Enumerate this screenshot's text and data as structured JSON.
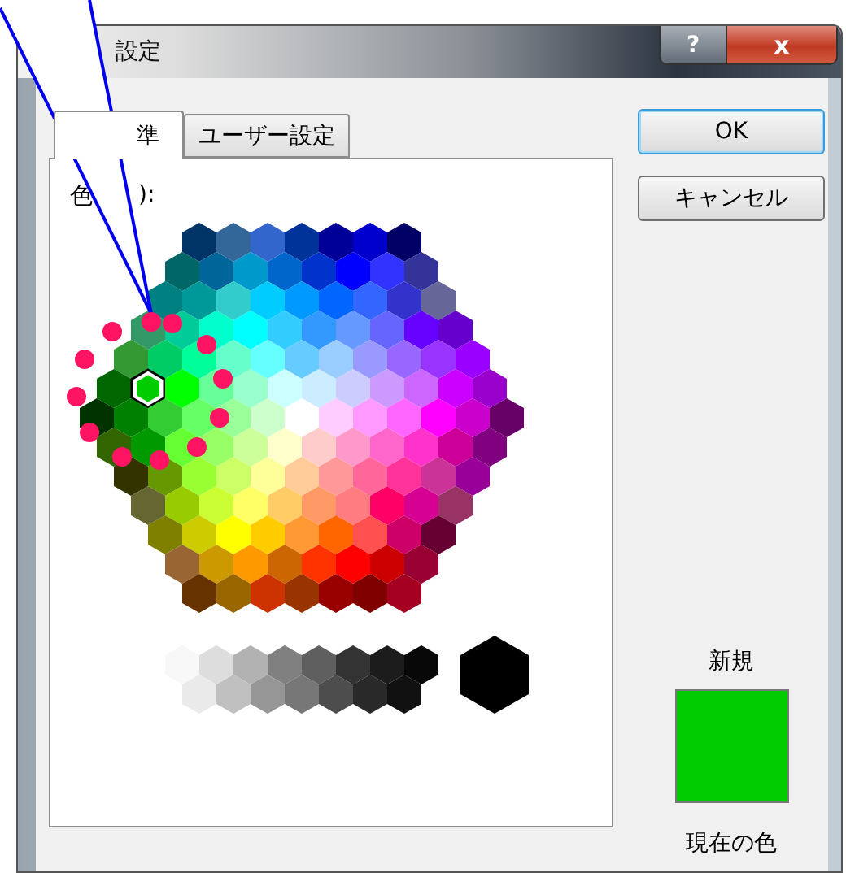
{
  "window": {
    "title": "設定",
    "help_button": "?",
    "close_button": "x"
  },
  "tabs": [
    {
      "label": "準",
      "selected": true
    },
    {
      "label": "ユーザー設定",
      "selected": false
    }
  ],
  "colors_label": {
    "start": "色",
    "end": "):"
  },
  "palette": {
    "rows": [
      [
        {
          "color": "#003366",
          "selected": false
        },
        {
          "color": "#336699",
          "selected": false
        },
        {
          "color": "#3366cc",
          "selected": false
        },
        {
          "color": "#003399",
          "selected": false
        },
        {
          "color": "#000099",
          "selected": false
        },
        {
          "color": "#0000cc",
          "selected": false
        },
        {
          "color": "#000066",
          "selected": false
        }
      ],
      [
        {
          "color": "#006666",
          "selected": false
        },
        {
          "color": "#006699",
          "selected": false
        },
        {
          "color": "#0099cc",
          "selected": false
        },
        {
          "color": "#0066cc",
          "selected": false
        },
        {
          "color": "#0033cc",
          "selected": false
        },
        {
          "color": "#0000ff",
          "selected": false
        },
        {
          "color": "#3333ff",
          "selected": false
        },
        {
          "color": "#333399",
          "selected": false
        }
      ],
      [
        {
          "color": "#008080",
          "selected": false
        },
        {
          "color": "#009999",
          "selected": false
        },
        {
          "color": "#33cccc",
          "selected": false
        },
        {
          "color": "#00ccff",
          "selected": false
        },
        {
          "color": "#0099ff",
          "selected": false
        },
        {
          "color": "#0066ff",
          "selected": false
        },
        {
          "color": "#3366ff",
          "selected": false
        },
        {
          "color": "#3333cc",
          "selected": false
        },
        {
          "color": "#666699",
          "selected": false
        }
      ],
      [
        {
          "color": "#339966",
          "selected": false
        },
        {
          "color": "#00cc99",
          "selected": false
        },
        {
          "color": "#00ffcc",
          "selected": false
        },
        {
          "color": "#00ffff",
          "selected": false
        },
        {
          "color": "#33ccff",
          "selected": false
        },
        {
          "color": "#3399ff",
          "selected": false
        },
        {
          "color": "#6699ff",
          "selected": false
        },
        {
          "color": "#6666ff",
          "selected": false
        },
        {
          "color": "#6600ff",
          "selected": false
        },
        {
          "color": "#6600cc",
          "selected": false
        }
      ],
      [
        {
          "color": "#339933",
          "selected": false
        },
        {
          "color": "#00cc66",
          "selected": false
        },
        {
          "color": "#00ff99",
          "selected": false
        },
        {
          "color": "#66ffcc",
          "selected": false
        },
        {
          "color": "#66ffff",
          "selected": false
        },
        {
          "color": "#66ccff",
          "selected": false
        },
        {
          "color": "#99ccff",
          "selected": false
        },
        {
          "color": "#9999ff",
          "selected": false
        },
        {
          "color": "#9966ff",
          "selected": false
        },
        {
          "color": "#9933ff",
          "selected": false
        },
        {
          "color": "#9900ff",
          "selected": false
        }
      ],
      [
        {
          "color": "#006600",
          "selected": false
        },
        {
          "color": "#00cc00",
          "selected": true
        },
        {
          "color": "#00ff00",
          "selected": false
        },
        {
          "color": "#66ff99",
          "selected": false
        },
        {
          "color": "#99ffcc",
          "selected": false
        },
        {
          "color": "#ccffff",
          "selected": false
        },
        {
          "color": "#ccecff",
          "selected": false
        },
        {
          "color": "#ccccff",
          "selected": false
        },
        {
          "color": "#cc99ff",
          "selected": false
        },
        {
          "color": "#cc66ff",
          "selected": false
        },
        {
          "color": "#cc00ff",
          "selected": false
        },
        {
          "color": "#9900cc",
          "selected": false
        }
      ],
      [
        {
          "color": "#003300",
          "selected": false
        },
        {
          "color": "#008000",
          "selected": false
        },
        {
          "color": "#33cc33",
          "selected": false
        },
        {
          "color": "#66ff66",
          "selected": false
        },
        {
          "color": "#99ff99",
          "selected": false
        },
        {
          "color": "#ccffcc",
          "selected": false
        },
        {
          "color": "#ffffff",
          "selected": false
        },
        {
          "color": "#ffccff",
          "selected": false
        },
        {
          "color": "#ff99ff",
          "selected": false
        },
        {
          "color": "#ff66ff",
          "selected": false
        },
        {
          "color": "#ff00ff",
          "selected": false
        },
        {
          "color": "#cc00cc",
          "selected": false
        },
        {
          "color": "#660066",
          "selected": false
        }
      ],
      [
        {
          "color": "#336600",
          "selected": false
        },
        {
          "color": "#009900",
          "selected": false
        },
        {
          "color": "#66ff33",
          "selected": false
        },
        {
          "color": "#99ff66",
          "selected": false
        },
        {
          "color": "#ccff99",
          "selected": false
        },
        {
          "color": "#ffffcc",
          "selected": false
        },
        {
          "color": "#ffcccc",
          "selected": false
        },
        {
          "color": "#ff99cc",
          "selected": false
        },
        {
          "color": "#ff66cc",
          "selected": false
        },
        {
          "color": "#ff33cc",
          "selected": false
        },
        {
          "color": "#cc0099",
          "selected": false
        },
        {
          "color": "#800080",
          "selected": false
        }
      ],
      [
        {
          "color": "#333300",
          "selected": false
        },
        {
          "color": "#669900",
          "selected": false
        },
        {
          "color": "#99ff33",
          "selected": false
        },
        {
          "color": "#ccff66",
          "selected": false
        },
        {
          "color": "#ffff99",
          "selected": false
        },
        {
          "color": "#ffcc99",
          "selected": false
        },
        {
          "color": "#ff9999",
          "selected": false
        },
        {
          "color": "#ff6699",
          "selected": false
        },
        {
          "color": "#ff3399",
          "selected": false
        },
        {
          "color": "#cc3399",
          "selected": false
        },
        {
          "color": "#990099",
          "selected": false
        }
      ],
      [
        {
          "color": "#666633",
          "selected": false
        },
        {
          "color": "#99cc00",
          "selected": false
        },
        {
          "color": "#ccff33",
          "selected": false
        },
        {
          "color": "#ffff66",
          "selected": false
        },
        {
          "color": "#ffcc66",
          "selected": false
        },
        {
          "color": "#ff9966",
          "selected": false
        },
        {
          "color": "#ff7c80",
          "selected": false
        },
        {
          "color": "#ff0066",
          "selected": false
        },
        {
          "color": "#d60093",
          "selected": false
        },
        {
          "color": "#993366",
          "selected": false
        }
      ],
      [
        {
          "color": "#808000",
          "selected": false
        },
        {
          "color": "#cccc00",
          "selected": false
        },
        {
          "color": "#ffff00",
          "selected": false
        },
        {
          "color": "#ffcc00",
          "selected": false
        },
        {
          "color": "#ff9933",
          "selected": false
        },
        {
          "color": "#ff6600",
          "selected": false
        },
        {
          "color": "#ff5050",
          "selected": false
        },
        {
          "color": "#cc0066",
          "selected": false
        },
        {
          "color": "#660033",
          "selected": false
        }
      ],
      [
        {
          "color": "#996633",
          "selected": false
        },
        {
          "color": "#cc9900",
          "selected": false
        },
        {
          "color": "#ff9900",
          "selected": false
        },
        {
          "color": "#cc6600",
          "selected": false
        },
        {
          "color": "#ff3300",
          "selected": false
        },
        {
          "color": "#ff0000",
          "selected": false
        },
        {
          "color": "#cc0000",
          "selected": false
        },
        {
          "color": "#990033",
          "selected": false
        }
      ],
      [
        {
          "color": "#663300",
          "selected": false
        },
        {
          "color": "#996600",
          "selected": false
        },
        {
          "color": "#cc3300",
          "selected": false
        },
        {
          "color": "#993300",
          "selected": false
        },
        {
          "color": "#990000",
          "selected": false
        },
        {
          "color": "#800000",
          "selected": false
        },
        {
          "color": "#a50021",
          "selected": false
        }
      ]
    ],
    "grays_top": [
      {
        "color": "#f8f8f8",
        "selected": false
      },
      {
        "color": "#dddddd",
        "selected": false
      },
      {
        "color": "#b2b2b2",
        "selected": false
      },
      {
        "color": "#808080",
        "selected": false
      },
      {
        "color": "#5f5f5f",
        "selected": false
      },
      {
        "color": "#333333",
        "selected": false
      },
      {
        "color": "#1c1c1c",
        "selected": false
      },
      {
        "color": "#080808",
        "selected": false
      }
    ],
    "grays_bottom": [
      {
        "color": "#eaeaea",
        "selected": false
      },
      {
        "color": "#c0c0c0",
        "selected": false
      },
      {
        "color": "#969696",
        "selected": false
      },
      {
        "color": "#777777",
        "selected": false
      },
      {
        "color": "#4d4d4d",
        "selected": false
      },
      {
        "color": "#292929",
        "selected": false
      },
      {
        "color": "#111111",
        "selected": false
      }
    ],
    "black": {
      "color": "#000000",
      "selected": false
    }
  },
  "buttons": [
    {
      "label": "OK",
      "default": true
    },
    {
      "label": "キャンセル",
      "default": false
    }
  ],
  "preview": {
    "new_label": "新規",
    "color": "#00cc00",
    "current_label": "現在の色"
  }
}
